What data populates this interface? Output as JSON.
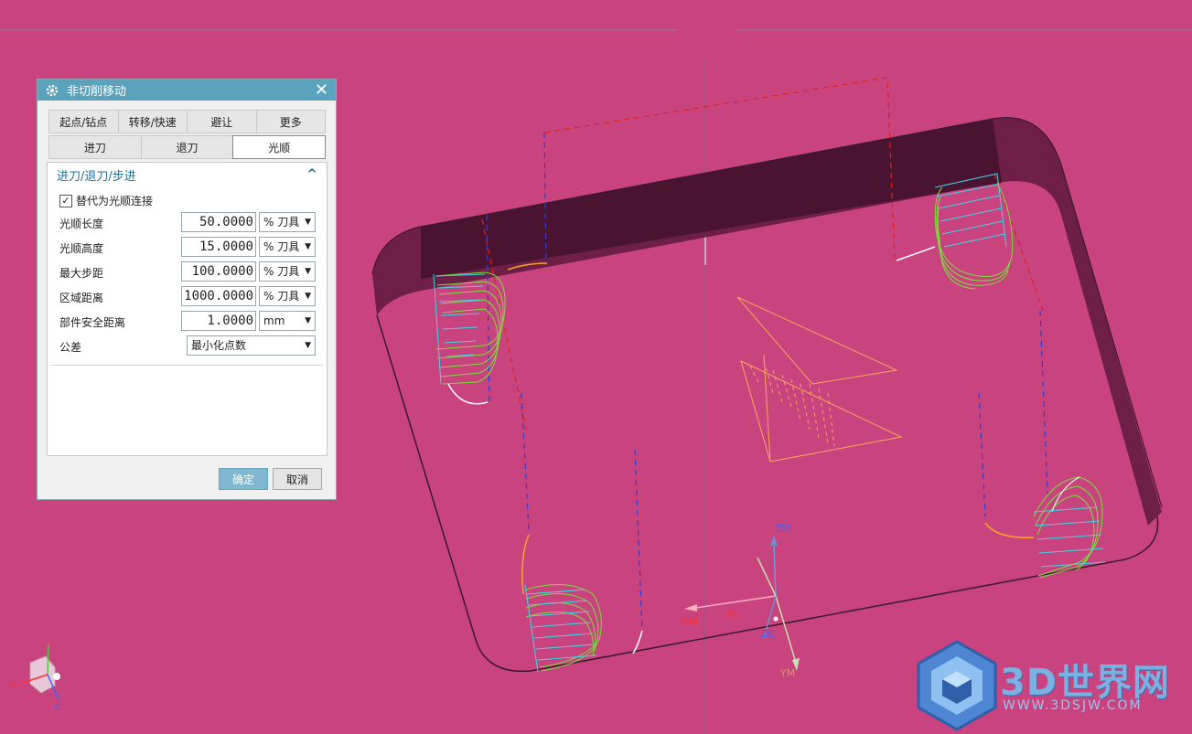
{
  "dialog": {
    "title": "非切削移动",
    "tabs_row1": [
      "起点/钻点",
      "转移/快速",
      "避让",
      "更多"
    ],
    "tabs_row2": [
      "进刀",
      "退刀",
      "光顺"
    ],
    "active_tab": "光顺",
    "section": "进刀/退刀/步进",
    "checkbox_label": "替代为光顺连接",
    "checkbox_checked": true,
    "fields": [
      {
        "label": "光顺长度",
        "value": "50.0000",
        "unit": "% 刀具"
      },
      {
        "label": "光顺高度",
        "value": "15.0000",
        "unit": "% 刀具"
      },
      {
        "label": "最大步距",
        "value": "100.0000",
        "unit": "% 刀具"
      },
      {
        "label": "区域距离",
        "value": "1000.0000",
        "unit": "% 刀具"
      },
      {
        "label": "部件安全距离",
        "value": "1.0000",
        "unit": "mm"
      }
    ],
    "tolerance": {
      "label": "公差",
      "value": "最小化点数"
    },
    "ok_label": "确定",
    "cancel_label": "取消"
  },
  "viewport": {
    "background": "#c9437f",
    "axes": {
      "zm": "ZM",
      "xm": "XM",
      "xc": "XC",
      "zc": "ZC",
      "ym": "YM"
    },
    "triad": {
      "x": "X",
      "z": "Z"
    }
  },
  "watermark": {
    "text": "3D世界网",
    "url": "WWW.3DSJW.COM"
  }
}
